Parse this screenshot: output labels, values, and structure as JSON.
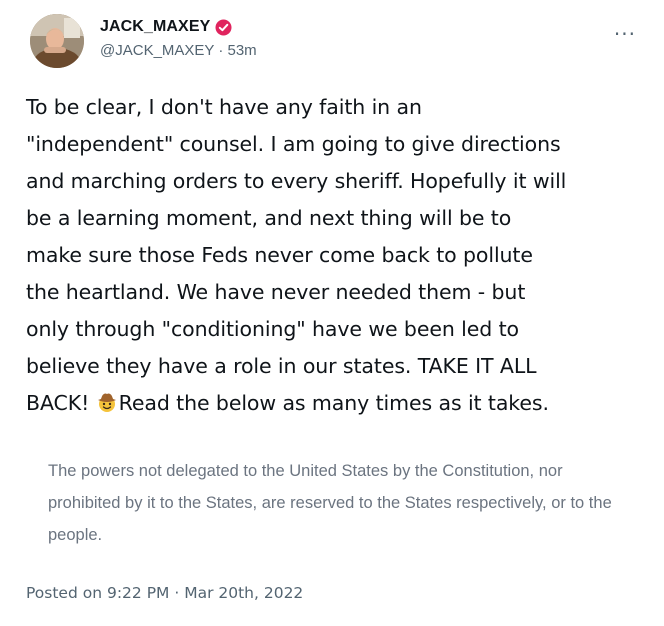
{
  "author": {
    "display_name": "JACK_MAXEY",
    "handle": "@JACK_MAXEY",
    "time_ago": "53m",
    "badge_color": "#e0245e"
  },
  "more_label": "···",
  "tweet": {
    "text_before_emoji": "To be clear, I don't have any faith in an\n\"independent\" counsel. I am going to give directions\nand marching orders to every sheriff. Hopefully it will\nbe a learning moment, and next thing will be to\nmake sure those Feds never come back to pollute\nthe heartland. We have never needed them - but\nonly through \"conditioning\" have we been led to\nbelieve they have a role in our states. TAKE IT ALL\nBACK! ",
    "emoji": "cowboy-hat-face",
    "text_after_emoji": "Read the below as many times as it takes."
  },
  "quote": {
    "text": "The powers not delegated to the United States by the Constitution, nor prohibited by it to the States, are reserved to the States respectively, or to the people."
  },
  "footer": {
    "posted": "Posted on 9:22 PM · Mar 20th, 2022"
  }
}
